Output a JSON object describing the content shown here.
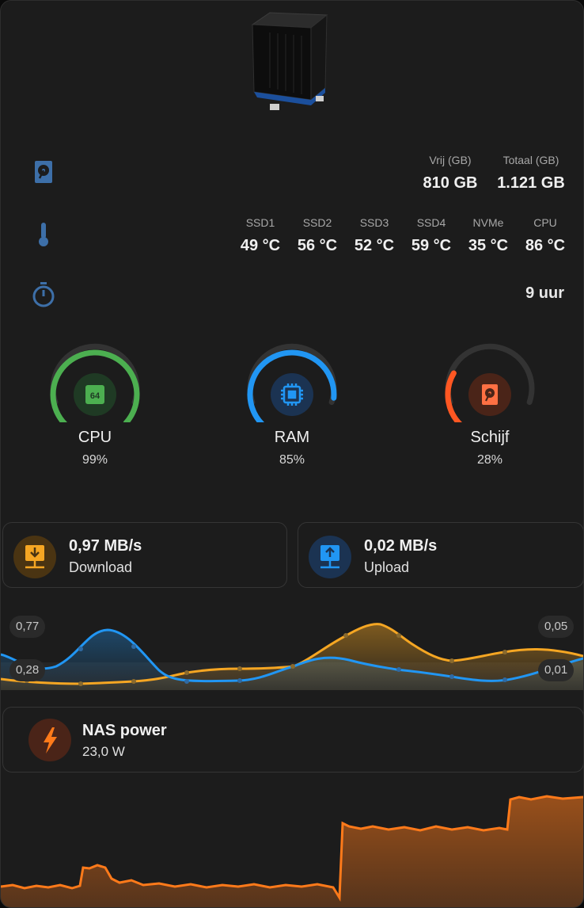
{
  "disk": {
    "free_label": "Vrij (GB)",
    "free_value": "810 GB",
    "total_label": "Totaal (GB)",
    "total_value": "1.121 GB"
  },
  "temps": [
    {
      "label": "SSD1",
      "value": "49 °C"
    },
    {
      "label": "SSD2",
      "value": "56 °C"
    },
    {
      "label": "SSD3",
      "value": "52 °C"
    },
    {
      "label": "SSD4",
      "value": "59 °C"
    },
    {
      "label": "NVMe",
      "value": "35 °C"
    },
    {
      "label": "CPU",
      "value": "86 °C"
    }
  ],
  "uptime": "9 uur",
  "gauges": [
    {
      "title": "CPU",
      "value": "99%",
      "fraction": 0.99,
      "color": "#4caf50",
      "icon": "cpu-64-icon"
    },
    {
      "title": "RAM",
      "value": "85%",
      "fraction": 0.85,
      "color": "#2196f3",
      "icon": "chip-icon"
    },
    {
      "title": "Schijf",
      "value": "28%",
      "fraction": 0.28,
      "color": "#ff5722",
      "icon": "harddisk-icon"
    }
  ],
  "network": {
    "download_value": "0,97 MB/s",
    "download_label": "Download",
    "upload_value": "0,02 MB/s",
    "upload_label": "Upload",
    "left_max": "0,77",
    "left_min": "0,28",
    "right_max": "0,05",
    "right_min": "0,01"
  },
  "power": {
    "title": "NAS power",
    "value": "23,0 W"
  },
  "colors": {
    "download": "#f5a623",
    "upload": "#2196f3",
    "power": "#ff7a1a"
  }
}
